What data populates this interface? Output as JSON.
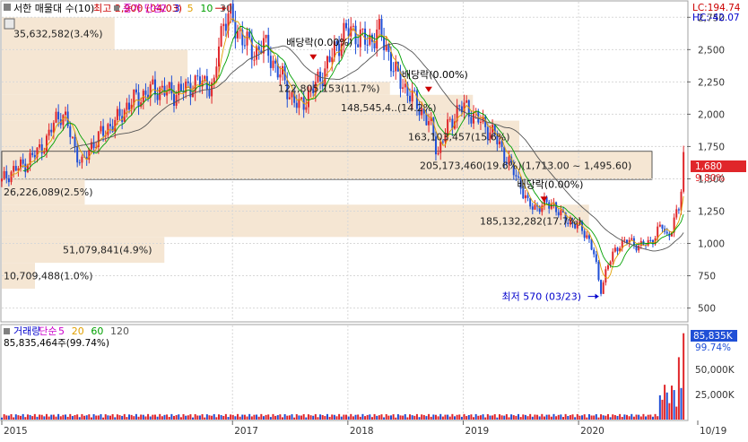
{
  "header": {
    "label": "서한 매물대 수(10)",
    "price_legend": [
      {
        "text": "종가 단순",
        "color": "#cc00cc"
      },
      {
        "text": "2",
        "color": "#cc00cc"
      },
      {
        "text": "3",
        "color": "#0000cc"
      },
      {
        "text": "5",
        "color": "#e0a000"
      },
      {
        "text": "10",
        "color": "#00a000"
      },
      {
        "text": "30",
        "color": "#555555"
      }
    ],
    "lc": "LC:194.74",
    "hc": "HC:-42.07"
  },
  "volume_panel": {
    "legend": [
      {
        "text": "거래량",
        "color": "#0000cc"
      },
      {
        "text": "단순",
        "color": "#cc00cc"
      },
      {
        "text": "5",
        "color": "#cc00cc"
      },
      {
        "text": "20",
        "color": "#e0a000"
      },
      {
        "text": "60",
        "color": "#00a000"
      },
      {
        "text": "120",
        "color": "#555555"
      }
    ],
    "last_volume": "85,835,464주(99.74%)",
    "current_badge": "85,835K",
    "current_pct": "99.74%",
    "ticks": [
      "50,000K",
      "25,000K"
    ]
  },
  "current_price": {
    "badge": "1,680",
    "change": "9.80%"
  },
  "colors": {
    "up": "#e0262a",
    "down": "#1f4fd6",
    "profile": "#f5e6d3",
    "badge": "#e0262a"
  },
  "chart_data": {
    "type": "candlestick",
    "price_axis": {
      "ticks": [
        500,
        750,
        1000,
        1250,
        1500,
        1750,
        2000,
        2250,
        2500,
        2750
      ],
      "labels": [
        "500",
        "750",
        "1,000",
        "1,250",
        "1,500",
        "1,750",
        "2,000",
        "2,250",
        "2,500",
        "2,750"
      ],
      "range": [
        400,
        2870
      ]
    },
    "x_axis": {
      "labels": [
        "2015",
        "2017",
        "2018",
        "2019",
        "2020",
        "10/19"
      ],
      "grid_years": [
        "2017",
        "2018",
        "2019",
        "2020"
      ]
    },
    "close_path": [
      {
        "t": 2015.0,
        "v": 1480
      },
      {
        "t": 2015.05,
        "v": 1530
      },
      {
        "t": 2015.12,
        "v": 1580
      },
      {
        "t": 2015.18,
        "v": 1600
      },
      {
        "t": 2015.25,
        "v": 1660
      },
      {
        "t": 2015.32,
        "v": 1720
      },
      {
        "t": 2015.4,
        "v": 1810
      },
      {
        "t": 2015.46,
        "v": 1960
      },
      {
        "t": 2015.52,
        "v": 2010
      },
      {
        "t": 2015.58,
        "v": 1890
      },
      {
        "t": 2015.64,
        "v": 1720
      },
      {
        "t": 2015.7,
        "v": 1600
      },
      {
        "t": 2015.76,
        "v": 1740
      },
      {
        "t": 2015.84,
        "v": 1820
      },
      {
        "t": 2015.92,
        "v": 1900
      },
      {
        "t": 2016.0,
        "v": 1950
      },
      {
        "t": 2016.08,
        "v": 2060
      },
      {
        "t": 2016.16,
        "v": 2120
      },
      {
        "t": 2016.24,
        "v": 2150
      },
      {
        "t": 2016.32,
        "v": 2200
      },
      {
        "t": 2016.4,
        "v": 2180
      },
      {
        "t": 2016.5,
        "v": 2160
      },
      {
        "t": 2016.6,
        "v": 2200
      },
      {
        "t": 2016.7,
        "v": 2250
      },
      {
        "t": 2016.78,
        "v": 2240
      },
      {
        "t": 2016.84,
        "v": 2200
      },
      {
        "t": 2016.88,
        "v": 2550
      },
      {
        "t": 2016.92,
        "v": 2700
      },
      {
        "t": 2016.96,
        "v": 2800
      },
      {
        "t": 2017.02,
        "v": 2650
      },
      {
        "t": 2017.1,
        "v": 2600
      },
      {
        "t": 2017.18,
        "v": 2450
      },
      {
        "t": 2017.26,
        "v": 2560
      },
      {
        "t": 2017.34,
        "v": 2420
      },
      {
        "t": 2017.42,
        "v": 2300
      },
      {
        "t": 2017.5,
        "v": 2150
      },
      {
        "t": 2017.58,
        "v": 2050
      },
      {
        "t": 2017.66,
        "v": 2150
      },
      {
        "t": 2017.74,
        "v": 2250
      },
      {
        "t": 2017.82,
        "v": 2380
      },
      {
        "t": 2017.9,
        "v": 2520
      },
      {
        "t": 2017.96,
        "v": 2620
      },
      {
        "t": 2018.02,
        "v": 2650
      },
      {
        "t": 2018.1,
        "v": 2600
      },
      {
        "t": 2018.18,
        "v": 2550
      },
      {
        "t": 2018.26,
        "v": 2650
      },
      {
        "t": 2018.34,
        "v": 2500
      },
      {
        "t": 2018.42,
        "v": 2300
      },
      {
        "t": 2018.5,
        "v": 2200
      },
      {
        "t": 2018.58,
        "v": 2100
      },
      {
        "t": 2018.66,
        "v": 2000
      },
      {
        "t": 2018.72,
        "v": 1900
      },
      {
        "t": 2018.78,
        "v": 1700
      },
      {
        "t": 2018.84,
        "v": 1850
      },
      {
        "t": 2018.9,
        "v": 1950
      },
      {
        "t": 2018.96,
        "v": 2050
      },
      {
        "t": 2019.02,
        "v": 2050
      },
      {
        "t": 2019.08,
        "v": 2000
      },
      {
        "t": 2019.14,
        "v": 1950
      },
      {
        "t": 2019.2,
        "v": 1900
      },
      {
        "t": 2019.26,
        "v": 1850
      },
      {
        "t": 2019.32,
        "v": 1750
      },
      {
        "t": 2019.38,
        "v": 1650
      },
      {
        "t": 2019.44,
        "v": 1550
      },
      {
        "t": 2019.5,
        "v": 1450
      },
      {
        "t": 2019.56,
        "v": 1300
      },
      {
        "t": 2019.62,
        "v": 1280
      },
      {
        "t": 2019.7,
        "v": 1300
      },
      {
        "t": 2019.78,
        "v": 1310
      },
      {
        "t": 2019.84,
        "v": 1220
      },
      {
        "t": 2019.9,
        "v": 1180
      },
      {
        "t": 2019.96,
        "v": 1150
      },
      {
        "t": 2020.02,
        "v": 1120
      },
      {
        "t": 2020.08,
        "v": 1050
      },
      {
        "t": 2020.14,
        "v": 900
      },
      {
        "t": 2020.19,
        "v": 620
      },
      {
        "t": 2020.24,
        "v": 800
      },
      {
        "t": 2020.3,
        "v": 920
      },
      {
        "t": 2020.36,
        "v": 1000
      },
      {
        "t": 2020.44,
        "v": 1020
      },
      {
        "t": 2020.52,
        "v": 980
      },
      {
        "t": 2020.6,
        "v": 1000
      },
      {
        "t": 2020.66,
        "v": 1050
      },
      {
        "t": 2020.72,
        "v": 1150
      },
      {
        "t": 2020.76,
        "v": 1050
      },
      {
        "t": 2020.8,
        "v": 1100
      },
      {
        "t": 2020.84,
        "v": 1200
      },
      {
        "t": 2020.88,
        "v": 1300
      },
      {
        "t": 2020.91,
        "v": 1680
      }
    ],
    "volume_profile": [
      {
        "label": "35,632,582(3.4%)",
        "from": 2500,
        "to": 2750,
        "pct": 3.4
      },
      {
        "label": "",
        "from": 2250,
        "to": 2500,
        "pct": 5.6
      },
      {
        "label": "122,805,153(11.7%)",
        "from": 2150,
        "to": 2250,
        "pct": 11.7
      },
      {
        "label": "148,545,4..(14.2%)",
        "from": 1950,
        "to": 2150,
        "pct": 14.2
      },
      {
        "label": "163,103,457(15.6%)",
        "from": 1700,
        "to": 1950,
        "pct": 15.6
      },
      {
        "label": "205,173,460(19.6%)(1,713.00 ~ 1,495.60)",
        "from": 1495.6,
        "to": 1713.0,
        "pct": 19.6
      },
      {
        "label": "26,226,089(2.5%)",
        "from": 1300,
        "to": 1495.6,
        "pct": 2.5
      },
      {
        "label": "185,132,282(17.7%)",
        "from": 1050,
        "to": 1300,
        "pct": 17.7
      },
      {
        "label": "51,079,841(4.9%)",
        "from": 850,
        "to": 1050,
        "pct": 4.9
      },
      {
        "label": "10,709,488(1.0%)",
        "from": 650,
        "to": 850,
        "pct": 1.0
      }
    ],
    "annotations": [
      {
        "text": "최고 2,900 (04/03)",
        "t": 2016.96,
        "v": 2820,
        "color": "#cc0000"
      },
      {
        "text": "최저 570 (03/23)",
        "t": 2020.19,
        "v": 590,
        "color": "#0000cc"
      },
      {
        "text": "배당락(0.00%)",
        "t": 2017.7,
        "v": 2490,
        "color": "#000000"
      },
      {
        "text": "배당락(0.00%)",
        "t": 2018.7,
        "v": 2240,
        "color": "#000000"
      },
      {
        "text": "배당락(0.00%)",
        "t": 2019.7,
        "v": 1390,
        "color": "#000000"
      }
    ],
    "volume_axis": {
      "ticks": [
        25000,
        50000
      ],
      "range": [
        0,
        90000
      ]
    }
  }
}
